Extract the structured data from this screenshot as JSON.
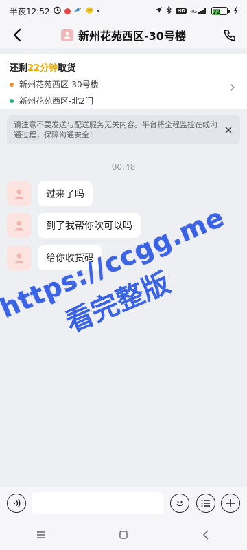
{
  "status_bar": {
    "time": "半夜12:52",
    "network": "4G",
    "battery": "72"
  },
  "header": {
    "title": "新州花苑西区-30号楼"
  },
  "order": {
    "prefix": "还剩",
    "minutes": "22分钟",
    "suffix": "取货",
    "addresses": [
      {
        "text": "新州花苑西区-30号楼",
        "color": "#f08a24"
      },
      {
        "text": "新州花苑西区-北2门",
        "color": "#22b573"
      }
    ]
  },
  "notice": {
    "text": "请注意不要发送与配送服务无关内容。平台将全程监控在线沟通过程，保障沟通安全！"
  },
  "chat": {
    "time": "00:48",
    "messages": [
      {
        "text": "过来了吗"
      },
      {
        "text": "到了我帮你吹可以吗"
      },
      {
        "text": "给你收货码"
      }
    ]
  },
  "watermark": {
    "line1": "https://ccgg.me",
    "line2": "看完整版"
  },
  "input": {
    "placeholder": ""
  },
  "colors": {
    "accent": "#f2a900",
    "watermark": "#3a63e6",
    "background": "#eeeff3"
  }
}
